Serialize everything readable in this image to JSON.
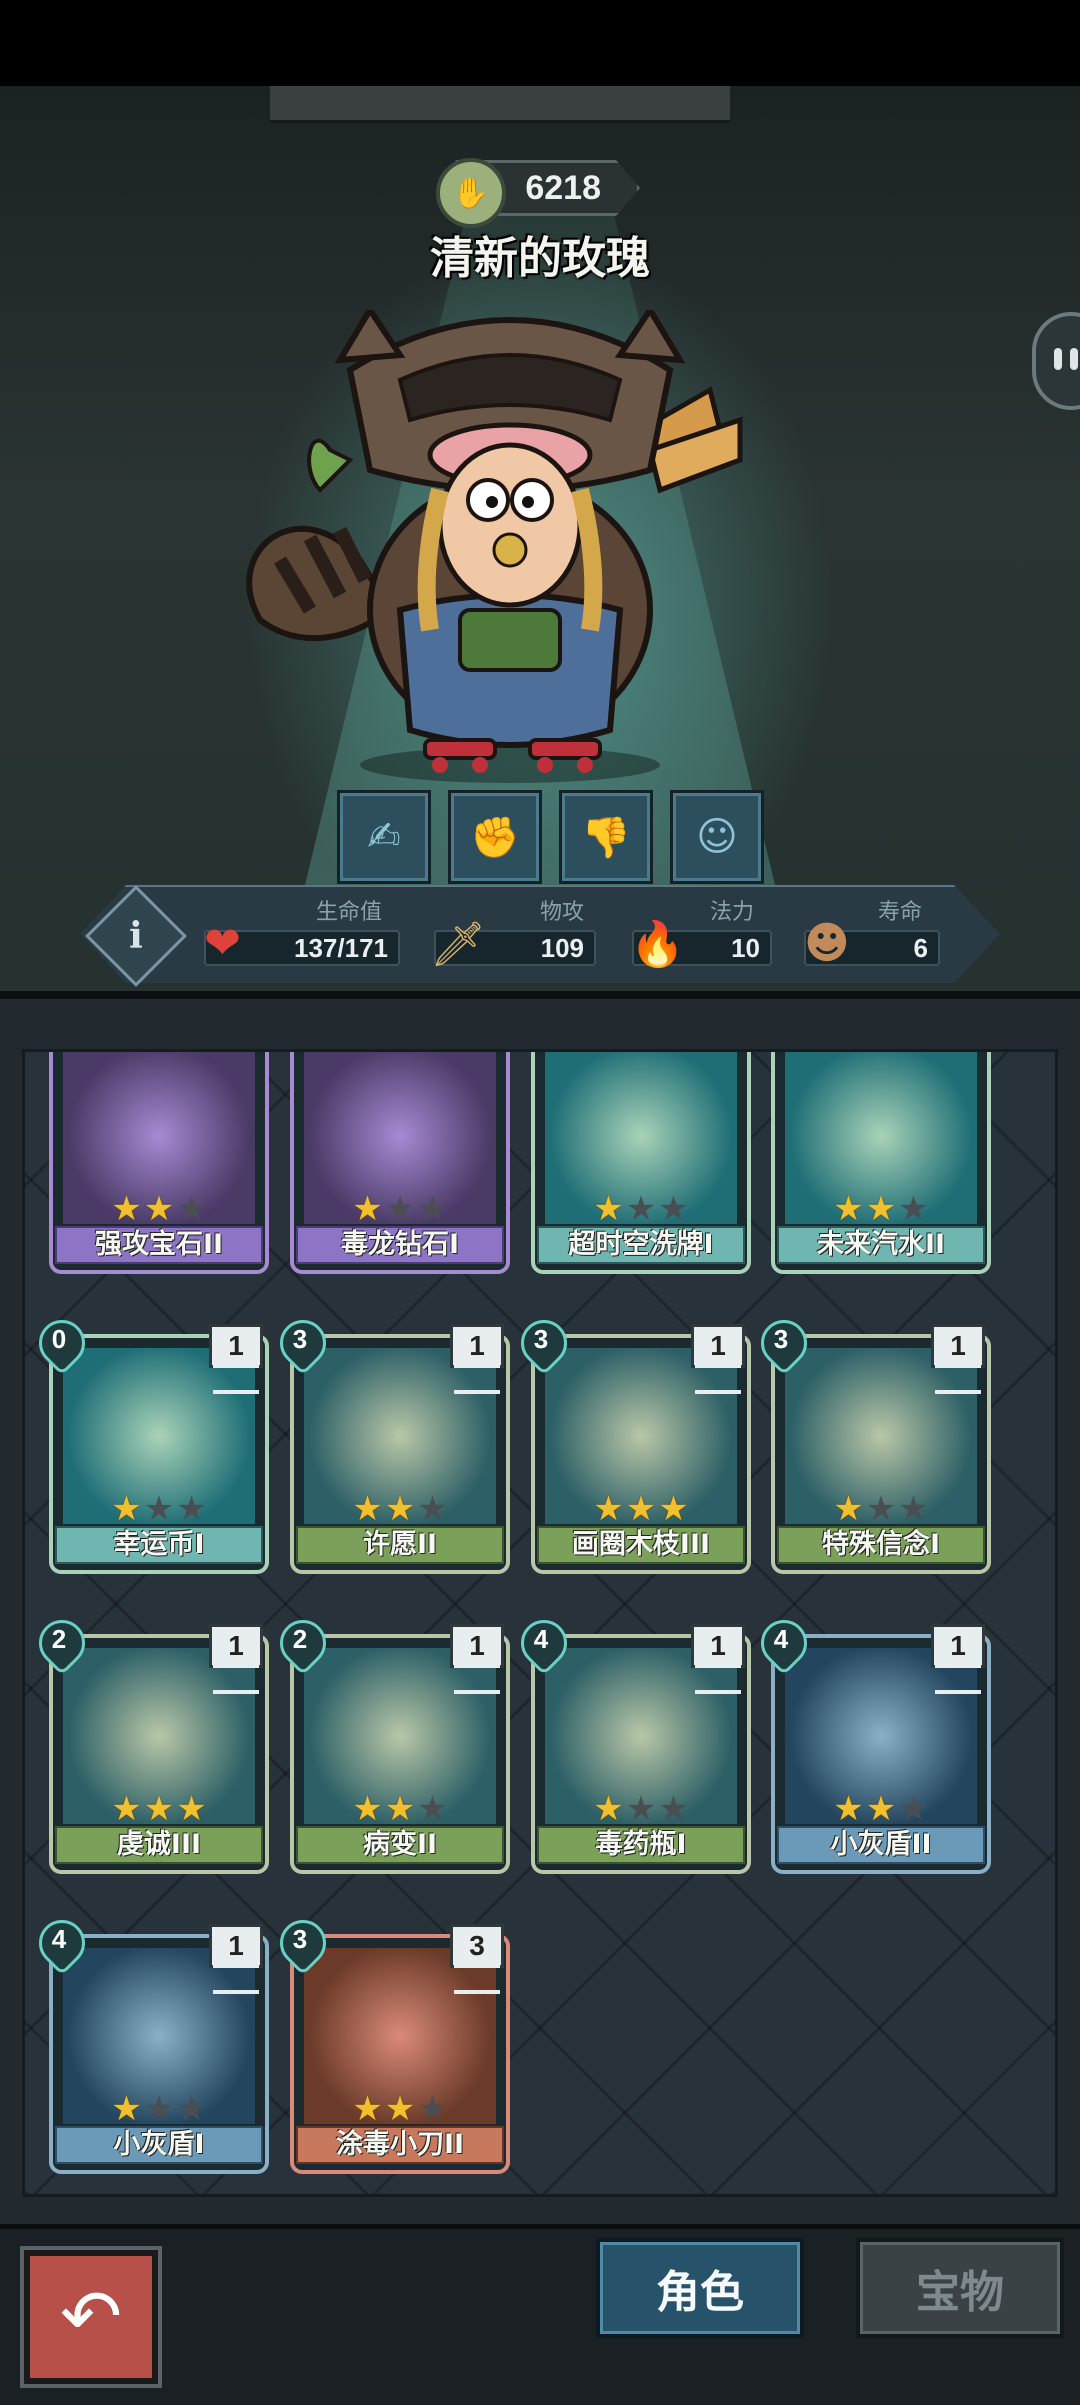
{
  "header": {
    "currency_icon": "clover-hand-icon",
    "currency_value": "6218",
    "character_name": "清新的玫瑰"
  },
  "skills": [
    {
      "icon": "feather-hand-icon"
    },
    {
      "icon": "fist-icon"
    },
    {
      "icon": "thumbs-down-icon"
    },
    {
      "icon": "figure-icon"
    }
  ],
  "stats": {
    "hp": {
      "label": "生命值",
      "value": "137/171",
      "icon": "heart-icon"
    },
    "attack": {
      "label": "物攻",
      "value": "109",
      "icon": "sword-icon"
    },
    "magic": {
      "label": "法力",
      "value": "10",
      "icon": "flame-icon"
    },
    "life": {
      "label": "寿命",
      "value": "6",
      "icon": "avatar-icon"
    }
  },
  "cards": [
    {
      "name": "强攻宝石II",
      "stars": 2,
      "theme": "purple"
    },
    {
      "name": "毒龙钻石I",
      "stars": 1,
      "theme": "purple"
    },
    {
      "name": "超时空洗牌I",
      "stars": 1,
      "theme": "teal"
    },
    {
      "name": "未来汽水II",
      "stars": 2,
      "theme": "teal"
    },
    {
      "name": "幸运币I",
      "stars": 1,
      "cost": "0",
      "count": "1",
      "theme": "teal"
    },
    {
      "name": "许愿II",
      "stars": 2,
      "cost": "3",
      "count": "1",
      "theme": "green"
    },
    {
      "name": "画圈木枝III",
      "stars": 3,
      "cost": "3",
      "count": "1",
      "theme": "green"
    },
    {
      "name": "特殊信念I",
      "stars": 1,
      "cost": "3",
      "count": "1",
      "theme": "green"
    },
    {
      "name": "虔诚III",
      "stars": 3,
      "cost": "2",
      "count": "1",
      "theme": "green"
    },
    {
      "name": "病变II",
      "stars": 2,
      "cost": "2",
      "count": "1",
      "theme": "green"
    },
    {
      "name": "毒药瓶I",
      "stars": 1,
      "cost": "4",
      "count": "1",
      "theme": "green"
    },
    {
      "name": "小灰盾II",
      "stars": 2,
      "cost": "4",
      "count": "1",
      "theme": "blue"
    },
    {
      "name": "小灰盾I",
      "stars": 1,
      "cost": "4",
      "count": "1",
      "theme": "blue"
    },
    {
      "name": "涂毒小刀II",
      "stars": 2,
      "cost": "3",
      "count": "3",
      "theme": "red"
    }
  ],
  "bottom": {
    "back_icon": "back-arrow-icon",
    "tab_role": "角色",
    "tab_treasure": "宝物"
  },
  "colors": {
    "accent": "#27536a",
    "star_on": "#f2c02d",
    "hp_red": "#e0423a"
  }
}
